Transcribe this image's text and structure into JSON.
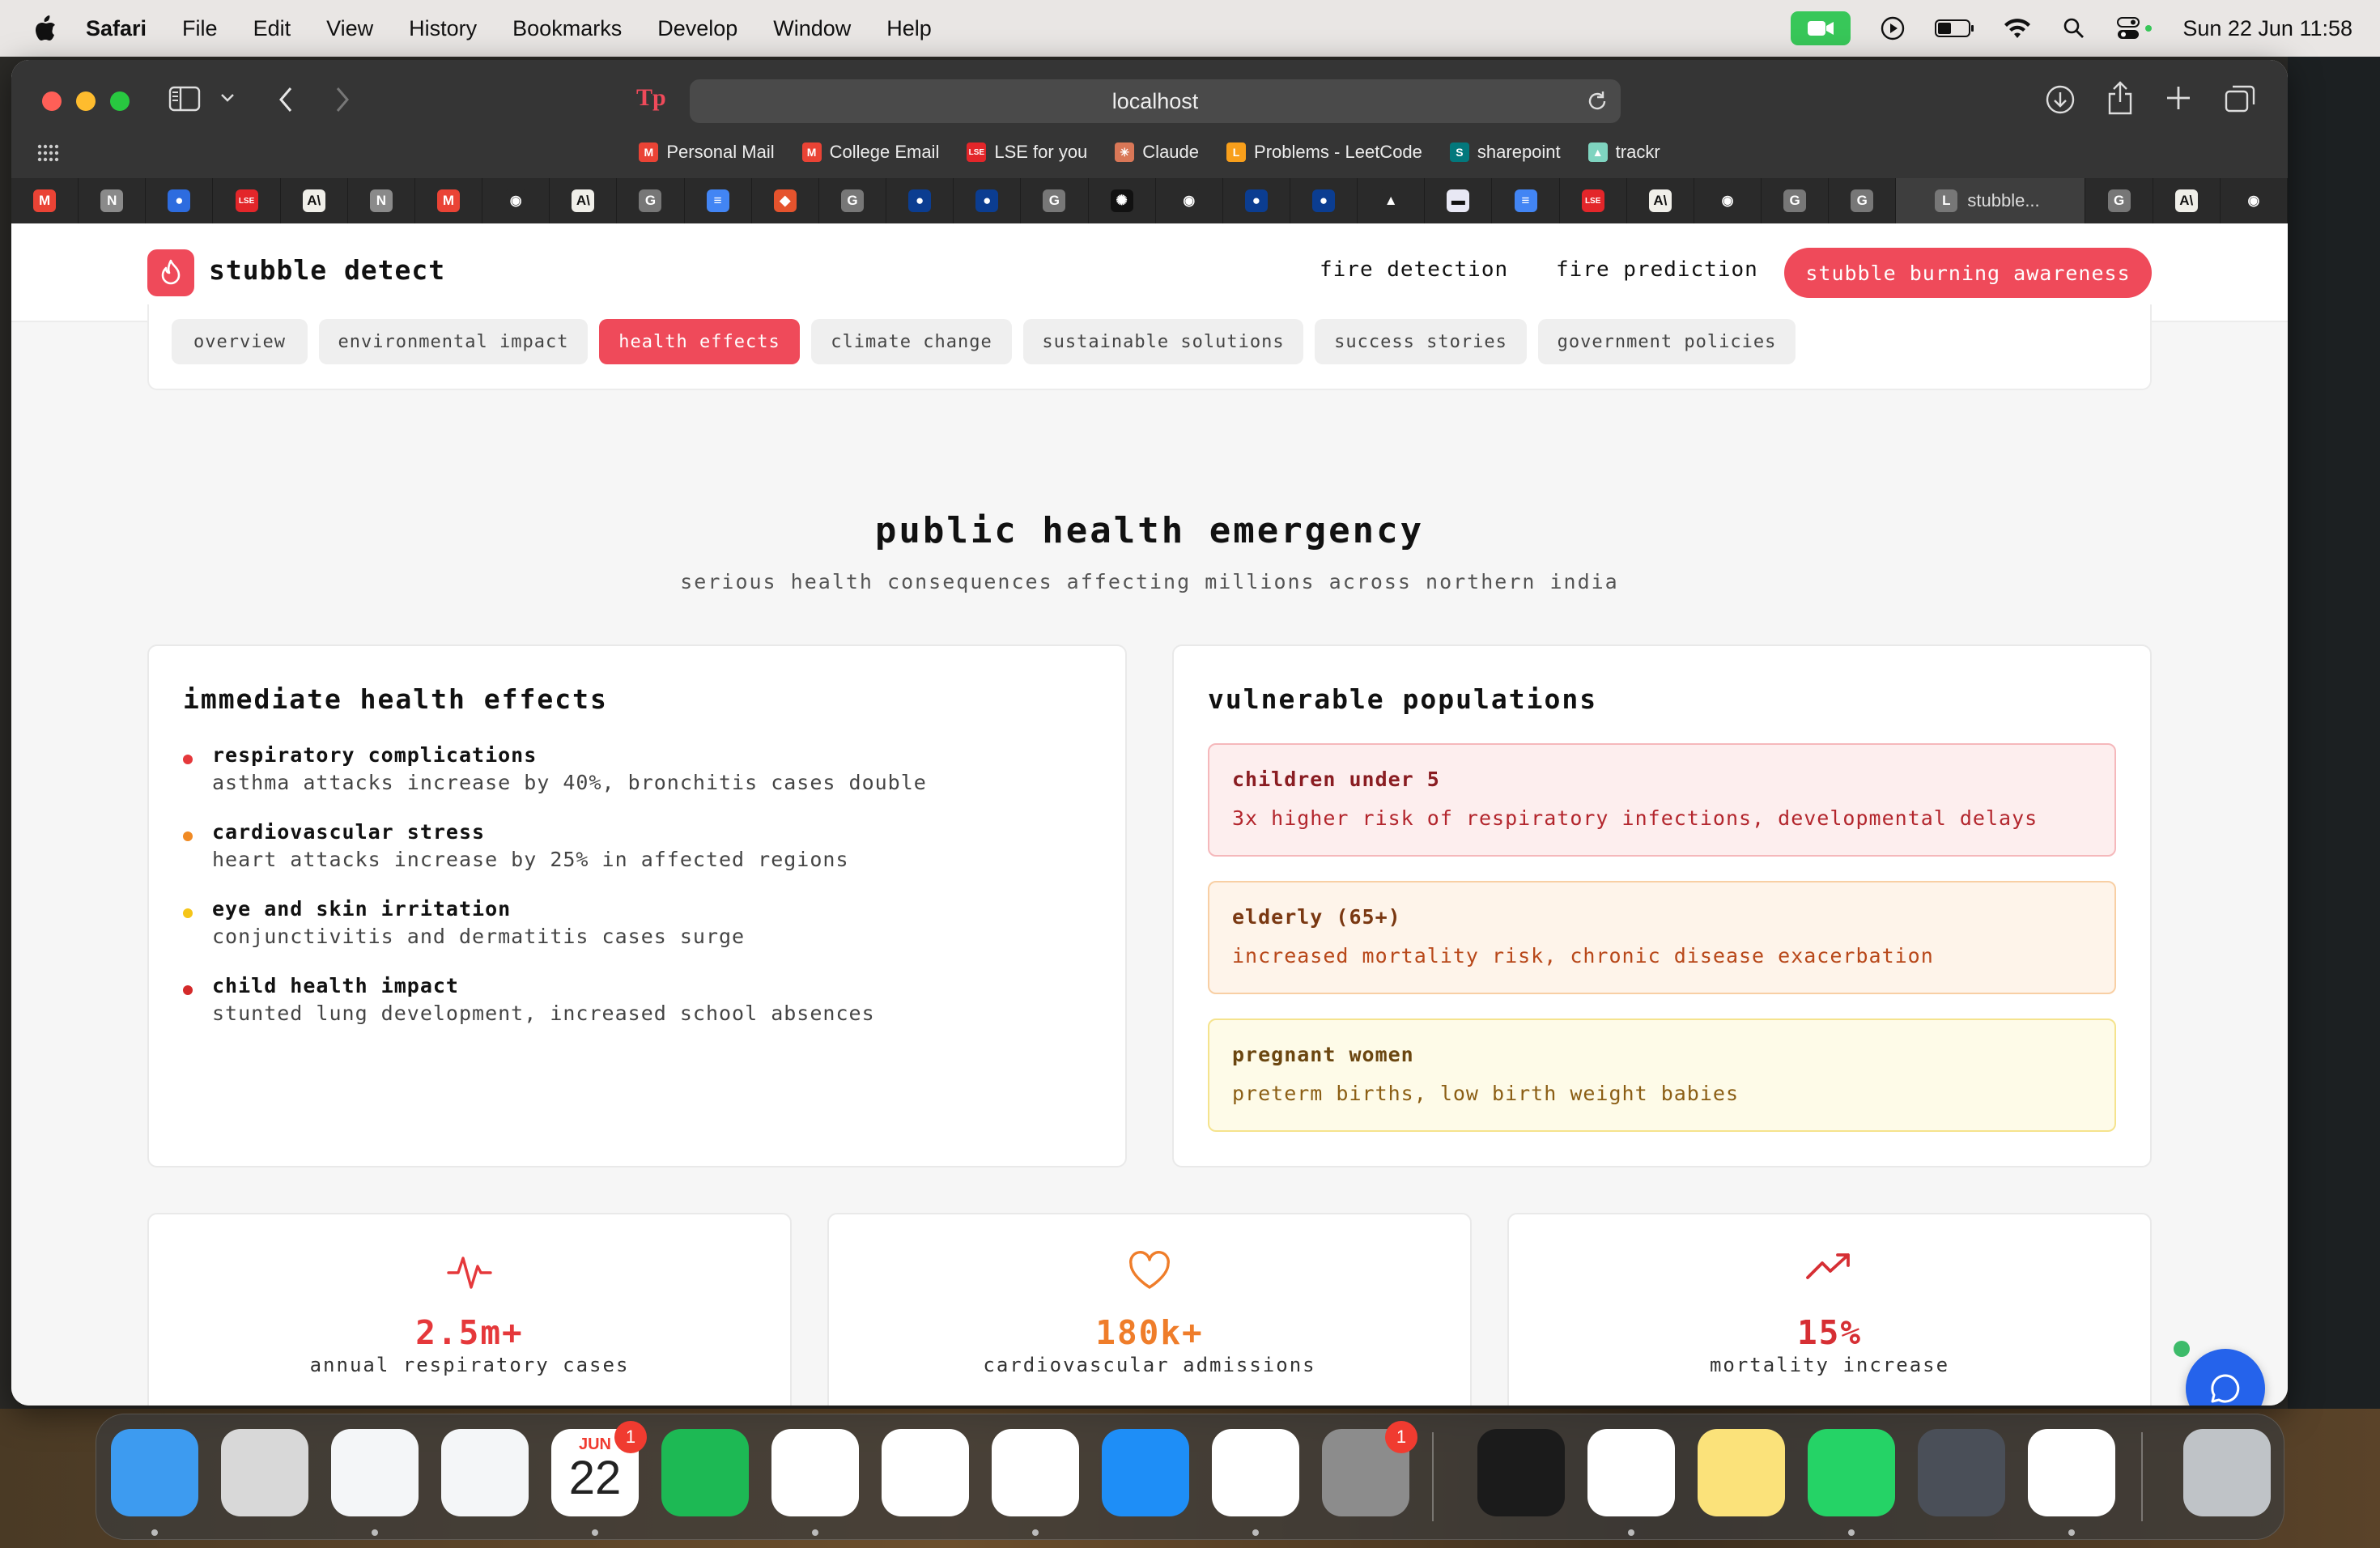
{
  "menubar": {
    "app": "Safari",
    "items": [
      "File",
      "Edit",
      "View",
      "History",
      "Bookmarks",
      "Develop",
      "Window",
      "Help"
    ],
    "clock": "Sun 22 Jun  11:58"
  },
  "browser": {
    "url": "localhost",
    "favorites": [
      {
        "label": "Personal Mail",
        "icon": "gmail-icon",
        "color": "#ea4335",
        "glyph": "M"
      },
      {
        "label": "College Email",
        "icon": "gmail-icon",
        "color": "#ea4335",
        "glyph": "M"
      },
      {
        "label": "LSE for you",
        "icon": "lse-icon",
        "color": "#e3262a",
        "glyph": "LSE"
      },
      {
        "label": "Claude",
        "icon": "claude-icon",
        "color": "#d97757",
        "glyph": "✳"
      },
      {
        "label": "Problems - LeetCode",
        "icon": "leetcode-icon",
        "color": "#f89f1b",
        "glyph": "L"
      },
      {
        "label": "sharepoint",
        "icon": "sharepoint-icon",
        "color": "#03787c",
        "glyph": "S"
      },
      {
        "label": "trackr",
        "icon": "trackr-icon",
        "color": "#7fd4c0",
        "glyph": "▲"
      }
    ],
    "tabs": [
      {
        "icon": "gmail-icon",
        "glyph": "M",
        "color": "#ea4335"
      },
      {
        "icon": "notion-icon",
        "glyph": "N",
        "color": "#8a8a8a"
      },
      {
        "icon": "globe-icon",
        "glyph": "●",
        "color": "#2d6cdf"
      },
      {
        "icon": "lse-icon",
        "glyph": "LSE",
        "color": "#e3262a"
      },
      {
        "icon": "anthropic-icon",
        "glyph": "A\\",
        "color": "#f0efe9"
      },
      {
        "icon": "notion-icon",
        "glyph": "N",
        "color": "#8a8a8a"
      },
      {
        "icon": "gmail-icon",
        "glyph": "M",
        "color": "#ea4335"
      },
      {
        "icon": "github-icon",
        "glyph": "◉",
        "color": "#2a2a2a"
      },
      {
        "icon": "anthropic-icon",
        "glyph": "A\\",
        "color": "#f0efe9"
      },
      {
        "icon": "g-icon",
        "glyph": "G",
        "color": "#777"
      },
      {
        "icon": "docs-icon",
        "glyph": "≡",
        "color": "#4285f4"
      },
      {
        "icon": "box-icon",
        "glyph": "◆",
        "color": "#e5532d"
      },
      {
        "icon": "g-icon",
        "glyph": "G",
        "color": "#777"
      },
      {
        "icon": "nasa-icon",
        "glyph": "●",
        "color": "#0b3d91"
      },
      {
        "icon": "nasa-icon",
        "glyph": "●",
        "color": "#0b3d91"
      },
      {
        "icon": "g-icon",
        "glyph": "G",
        "color": "#777"
      },
      {
        "icon": "openai-icon",
        "glyph": "✺",
        "color": "#111"
      },
      {
        "icon": "github-icon",
        "glyph": "◉",
        "color": "#2a2a2a"
      },
      {
        "icon": "nasa-icon",
        "glyph": "●",
        "color": "#0b3d91"
      },
      {
        "icon": "nasa-icon",
        "glyph": "●",
        "color": "#0b3d91"
      },
      {
        "icon": "trackr-icon",
        "glyph": "▲",
        "color": "#2a2a2a"
      },
      {
        "icon": "bar-icon",
        "glyph": "▬",
        "color": "#e8e8f4"
      },
      {
        "icon": "docs-icon",
        "glyph": "≡",
        "color": "#4285f4"
      },
      {
        "icon": "lse-icon",
        "glyph": "LSE",
        "color": "#e3262a"
      },
      {
        "icon": "anthropic-icon",
        "glyph": "A\\",
        "color": "#f0efe9"
      },
      {
        "icon": "github-icon",
        "glyph": "◉",
        "color": "#2a2a2a"
      },
      {
        "icon": "g-icon",
        "glyph": "G",
        "color": "#777"
      },
      {
        "icon": "g-icon",
        "glyph": "G",
        "color": "#777"
      }
    ],
    "active_tab": {
      "label": "stubble...",
      "glyph": "L"
    },
    "tabs_after": [
      {
        "icon": "g-icon",
        "glyph": "G",
        "color": "#777"
      },
      {
        "icon": "anthropic-icon",
        "glyph": "A\\",
        "color": "#f0efe9"
      },
      {
        "icon": "github-icon",
        "glyph": "◉",
        "color": "#2a2a2a"
      }
    ]
  },
  "site": {
    "brand": "stubble detect",
    "nav": {
      "fire_detection": "fire detection",
      "fire_prediction": "fire prediction",
      "awareness": "stubble burning awareness"
    },
    "subtabs": [
      "overview",
      "environmental impact",
      "health effects",
      "climate change",
      "sustainable solutions",
      "success stories",
      "government policies"
    ],
    "active_subtab": "health effects",
    "section": {
      "title": "public health emergency",
      "subtitle": "serious health consequences affecting millions across northern india"
    },
    "effects_card": {
      "title": "immediate health effects",
      "items": [
        {
          "title": "respiratory complications",
          "desc": "asthma attacks increase by 40%, bronchitis cases double",
          "color": "#e5383b"
        },
        {
          "title": "cardiovascular stress",
          "desc": "heart attacks increase by 25% in affected regions",
          "color": "#f08a24"
        },
        {
          "title": "eye and skin irritation",
          "desc": "conjunctivitis and dermatitis cases surge",
          "color": "#f5c518"
        },
        {
          "title": "child health impact",
          "desc": "stunted lung development, increased school absences",
          "color": "#d42a2a"
        }
      ]
    },
    "populations_card": {
      "title": "vulnerable populations",
      "items": [
        {
          "title": "children under 5",
          "desc": "3x higher risk of respiratory infections, developmental delays",
          "bg": "#fdeeee",
          "border": "#f5b8bb",
          "title_color": "#8a1d22",
          "desc_color": "#b3262d"
        },
        {
          "title": "elderly (65+)",
          "desc": "increased mortality risk, chronic disease exacerbation",
          "bg": "#fef4ea",
          "border": "#f8cfa4",
          "title_color": "#7a3812",
          "desc_color": "#b8481a"
        },
        {
          "title": "pregnant women",
          "desc": "preterm births, low birth weight babies",
          "bg": "#fefbe8",
          "border": "#f5e38d",
          "title_color": "#6b4610",
          "desc_color": "#8b5e14"
        }
      ]
    },
    "stats": [
      {
        "value": "2.5m+",
        "label": "annual respiratory cases",
        "icon": "pulse-icon",
        "color": "#e5383b"
      },
      {
        "value": "180k+",
        "label": "cardiovascular admissions",
        "icon": "heart-icon",
        "color": "#ef7d2a"
      },
      {
        "value": "15%",
        "label": "mortality increase",
        "icon": "trending-up-icon",
        "color": "#d62f34"
      }
    ]
  },
  "dock": {
    "apps": [
      {
        "name": "finder",
        "color": "#3d9bf0"
      },
      {
        "name": "launchpad",
        "color": "#d8d8d8"
      },
      {
        "name": "safari",
        "color": "#f4f6f8"
      },
      {
        "name": "outlook",
        "color": "#f4f6f8"
      },
      {
        "name": "calendar",
        "color": "#ffffff",
        "month": "JUN",
        "day": "22",
        "badge": "1"
      },
      {
        "name": "spotify",
        "color": "#1db954"
      },
      {
        "name": "notion",
        "color": "#ffffff"
      },
      {
        "name": "todo",
        "color": "#ffffff"
      },
      {
        "name": "word",
        "color": "#ffffff"
      },
      {
        "name": "app-store",
        "color": "#1e8ef7"
      },
      {
        "name": "excel",
        "color": "#ffffff"
      },
      {
        "name": "system-settings",
        "color": "#8c8c8c",
        "badge": "1"
      },
      {
        "name": "terminal",
        "color": "#1b1b1b"
      },
      {
        "name": "vscode",
        "color": "#ffffff"
      },
      {
        "name": "notes",
        "color": "#fbe27a"
      },
      {
        "name": "whatsapp",
        "color": "#25d366"
      },
      {
        "name": "quicktime",
        "color": "#4a4f58"
      },
      {
        "name": "imovie",
        "color": "#ffffff"
      },
      {
        "name": "trash",
        "color": "#bfc3c7"
      }
    ]
  }
}
